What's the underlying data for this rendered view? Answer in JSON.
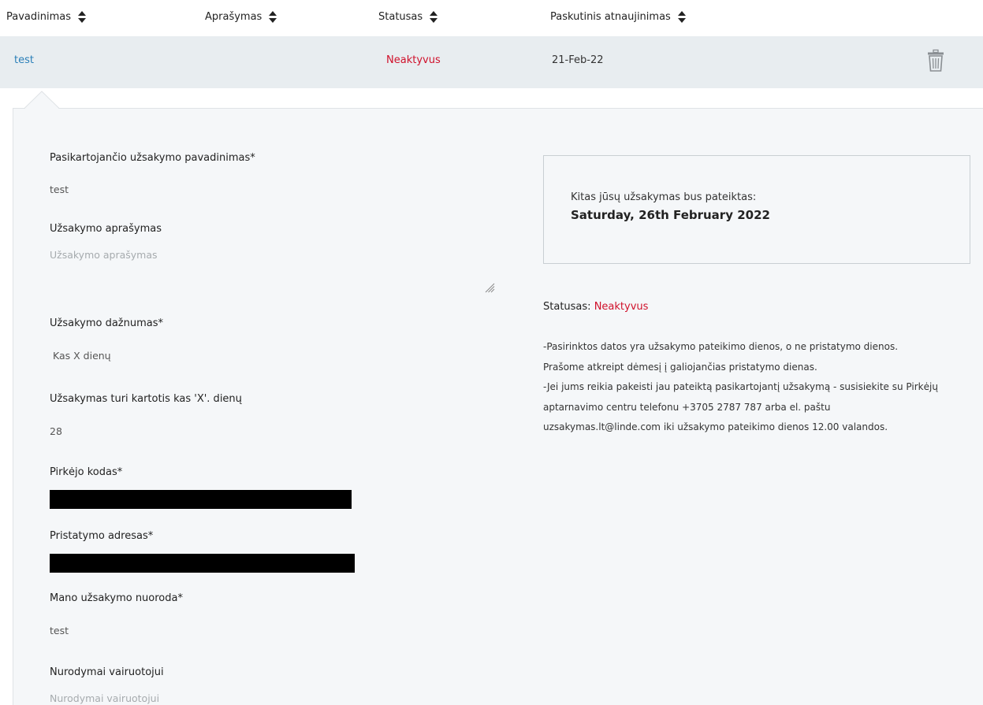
{
  "table": {
    "headers": {
      "name": "Pavadinimas",
      "description": "Aprašymas",
      "status": "Statusas",
      "updated": "Paskutinis atnaujinimas"
    },
    "row": {
      "name": "test",
      "status": "Neaktyvus",
      "updated": "21-Feb-22"
    }
  },
  "details": {
    "order_name_label": "Pasikartojančio užsakymo pavadinimas*",
    "order_name_value": "test",
    "description_label": "Užsakymo aprašymas",
    "description_placeholder": "Užsakymo aprašymas",
    "frequency_label": "Užsakymo dažnumas*",
    "frequency_value": "Kas X dienų",
    "repeat_label": "Užsakymas turi kartotis kas 'X'. dienų",
    "repeat_value": "28",
    "buyer_code_label": "Pirkėjo kodas*",
    "delivery_address_label": "Pristatymo adresas*",
    "order_reference_label": "Mano užsakymo nuoroda*",
    "order_reference_value": "test",
    "driver_notes_label": "Nurodymai vairuotojui",
    "driver_notes_placeholder": "Nurodymai vairuotojui"
  },
  "notice": {
    "line1": "Kitas jūsų užsakymas bus pateiktas:",
    "date": "Saturday, 26th February 2022"
  },
  "status_info": {
    "label": "Statusas: ",
    "value": "Neaktyvus",
    "lines": [
      "-Pasirinktos datos yra užsakymo pateikimo dienos, o ne pristatymo dienos.",
      "Prašome atkreipt dėmesį į galiojančias pristatymo dienas.",
      "-Jei jums reikia pakeisti jau pateiktą pasikartojantį užsakymą - susisiekite su Pirkėjų",
      "aptarnavimo centru telefonu +3705 2787 787 arba el. paštu",
      "uzsakymas.lt@linde.com iki užsakymo pateikimo dienos 12.00 valandos."
    ]
  },
  "colors": {
    "link": "#2a7fb8",
    "inactive": "#d0112b",
    "row_bg": "#e8edf0"
  }
}
